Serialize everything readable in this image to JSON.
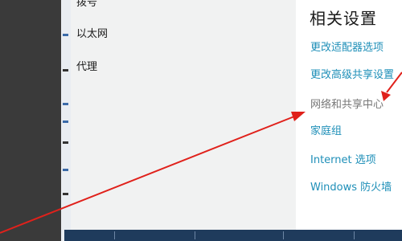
{
  "nav": {
    "items": [
      {
        "id": "partial",
        "label": "拨号"
      },
      {
        "id": "ethernet",
        "label": "以太网"
      },
      {
        "id": "proxy",
        "label": "代理"
      }
    ]
  },
  "related": {
    "title": "相关设置",
    "links": [
      {
        "id": "adapter",
        "label": "更改适配器选项"
      },
      {
        "id": "sharing",
        "label": "更改高级共享设置"
      },
      {
        "id": "network-center",
        "label": "网络和共享中心"
      },
      {
        "id": "homegroup",
        "label": "家庭组"
      },
      {
        "id": "internet-options",
        "label": "Internet 选项"
      },
      {
        "id": "firewall",
        "label": "Windows 防火墙"
      }
    ]
  },
  "colors": {
    "link": "#1e8fb8",
    "arrow": "#e0211b",
    "nav_bg": "#f1f2f2"
  }
}
